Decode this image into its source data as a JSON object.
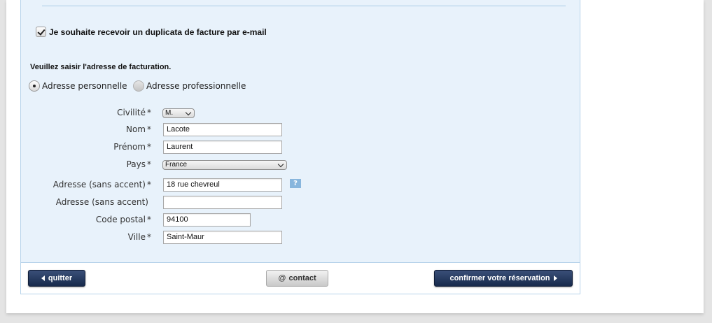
{
  "email_duplicate": {
    "label": "Je souhaite recevoir un duplicata de facture par e-mail",
    "checked": true
  },
  "billing": {
    "title": "Veuillez saisir l'adresse de facturation.",
    "address_types": [
      {
        "label": "Adresse personnelle",
        "selected": true
      },
      {
        "label": "Adresse professionnelle",
        "selected": false
      }
    ]
  },
  "form": {
    "civilite": {
      "label": "Civilité",
      "value": "M."
    },
    "nom": {
      "label": "Nom",
      "value": "Lacote"
    },
    "prenom": {
      "label": "Prénom",
      "value": "Laurent"
    },
    "pays": {
      "label": "Pays",
      "value": "France"
    },
    "adresse1": {
      "label": "Adresse (sans accent)",
      "value": "18 rue chevreul"
    },
    "adresse2": {
      "label": "Adresse (sans accent)",
      "value": ""
    },
    "code_postal": {
      "label": "Code postal",
      "value": "94100"
    },
    "ville": {
      "label": "Ville",
      "value": "Saint-Maur"
    },
    "required_mark": "*",
    "help_glyph": "?"
  },
  "footer": {
    "quit_label": "quitter",
    "contact_label": "contact",
    "contact_symbol": "@",
    "confirm_label": "confirmer votre réservation"
  },
  "icons": [
    "check-icon",
    "radio-icon",
    "chevron-down-icon",
    "help-icon",
    "arrow-left-icon",
    "arrow-right-icon",
    "at-icon"
  ],
  "colors": {
    "panel_bg": "#e8f2fb",
    "panel_border": "#b7d3ea",
    "dark_button": "#172a4c",
    "help_badge": "#88b6dd"
  }
}
